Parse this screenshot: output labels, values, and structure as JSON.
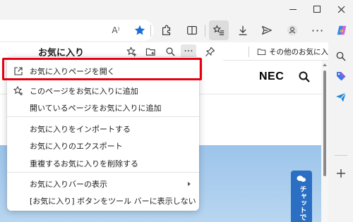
{
  "toolbar": {
    "read_aloud_glyph": "A⁾",
    "more_glyph": "···"
  },
  "favorites_panel": {
    "title": "お気に入り",
    "more_glyph": "···"
  },
  "favorites_bar": {
    "other_favorites_label": "その他のお気に入り"
  },
  "page": {
    "logo_text": "NEC",
    "chat_tab_label": "チャットで"
  },
  "menu": {
    "items": [
      {
        "label": "お気に入りページを開く",
        "icon": "open-external-icon",
        "submenu": false
      },
      {
        "label": "このページをお気に入りに追加",
        "icon": "star-add-icon",
        "submenu": false
      },
      {
        "label": "開いているページをお気に入りに追加",
        "icon": "",
        "submenu": false
      },
      {
        "label": "お気に入りをインポートする",
        "icon": "",
        "submenu": false
      },
      {
        "label": "お気に入りのエクスポート",
        "icon": "",
        "submenu": false
      },
      {
        "label": "重複するお気に入りを削除する",
        "icon": "",
        "submenu": false
      },
      {
        "label": "お気に入りバーの表示",
        "icon": "",
        "submenu": true
      },
      {
        "label": "[お気に入り] ボタンをツール バーに表示しない",
        "icon": "",
        "submenu": false
      }
    ]
  },
  "colors": {
    "highlight": "#e60012",
    "accent_blue": "#1a6fd6",
    "chat_tab": "#2a6fc3"
  }
}
